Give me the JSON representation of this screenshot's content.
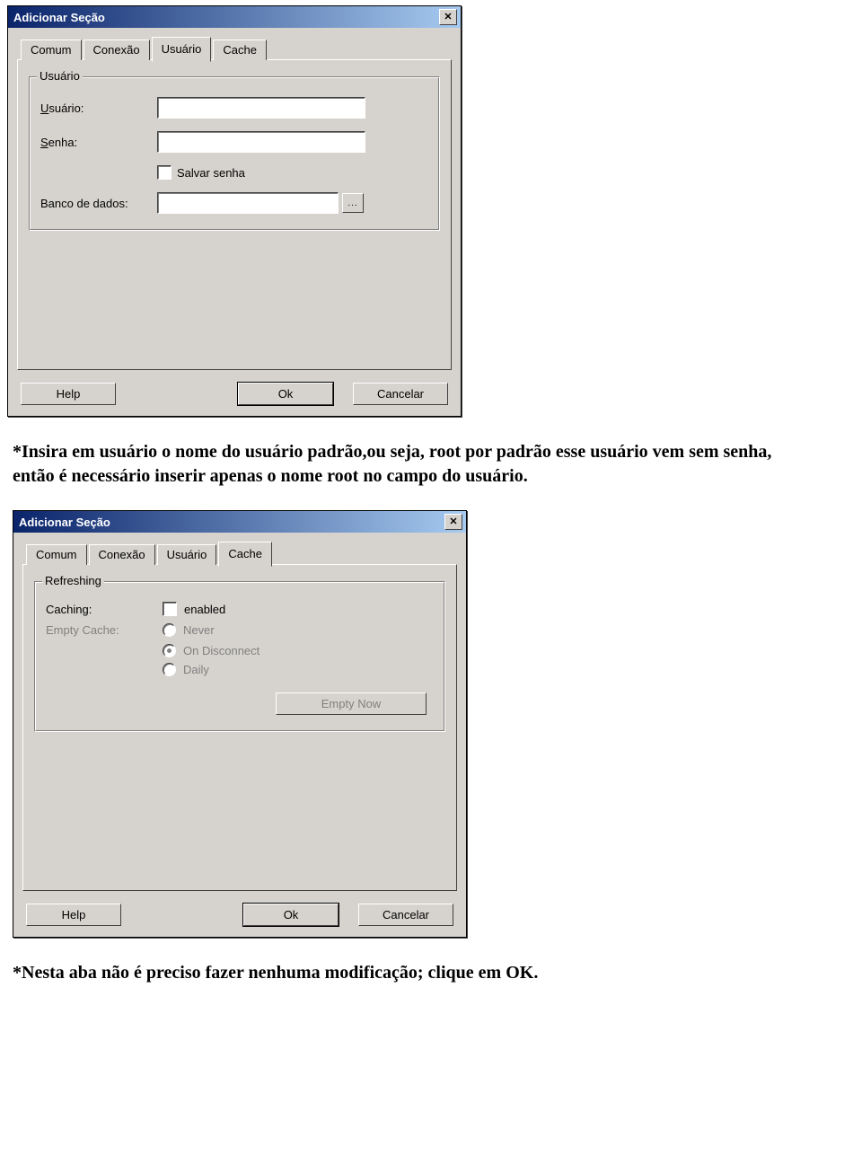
{
  "dialog1": {
    "title": "Adicionar Seção",
    "tabs": [
      "Comum",
      "Conexão",
      "Usuário",
      "Cache"
    ],
    "active_tab": "Usuário",
    "group": {
      "legend": "Usuário",
      "user_label_pre": "U",
      "user_label_rest": "suário:",
      "senha_label_pre": "S",
      "senha_label_rest": "enha:",
      "save_pw": "Salvar senha",
      "db_label_pre": "B",
      "db_label_rest": "anco de dados:",
      "browse": "..."
    },
    "buttons": {
      "help": "Help",
      "ok": "Ok",
      "cancel": "Cancelar"
    }
  },
  "text1": "*Insira em usuário o nome do usuário padrão,ou seja, root por padrão esse usuário vem sem senha, então é necessário inserir apenas o nome root no campo do usuário.",
  "dialog2": {
    "title": "Adicionar Seção",
    "tabs": [
      "Comum",
      "Conexão",
      "Usuário",
      "Cache"
    ],
    "active_tab": "Cache",
    "group": {
      "legend": "Refreshing",
      "caching_label": "Caching:",
      "enabled": "enabled",
      "empty_cache_label": "Empty Cache:",
      "opt_never": "Never",
      "opt_disconnect": "On Disconnect",
      "opt_daily": "Daily",
      "empty_now": "Empty Now"
    },
    "buttons": {
      "help": "Help",
      "ok": "Ok",
      "cancel": "Cancelar"
    }
  },
  "text2": "*Nesta aba não é preciso fazer nenhuma modificação; clique em OK."
}
